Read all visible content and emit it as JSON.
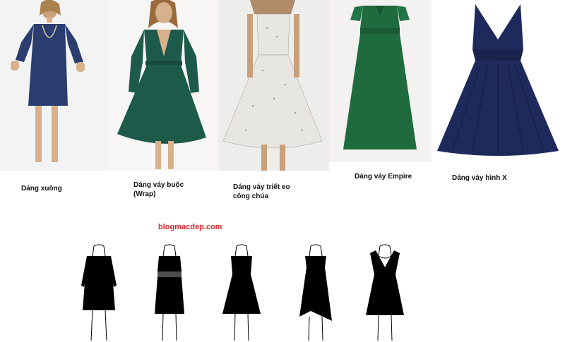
{
  "captions": {
    "shift": "Dáng xuông",
    "wrap": [
      "Dáng váy buộc",
      "(Wrap)"
    ],
    "princess": [
      "Dáng váy triết eo",
      "công chúa"
    ],
    "empire": "Dáng váy Empire",
    "x_shape": "Dáng váy hình X"
  },
  "watermark": "blogmacdep.com",
  "colors": {
    "shift_dress": "#2a3d6e",
    "wrap_dress": "#1d5a4a",
    "princess_dress": "#e8e6e2",
    "empire_dress": "#1f6b3d",
    "x_dress": "#1f2a5c",
    "watermark": "#e0242b"
  }
}
